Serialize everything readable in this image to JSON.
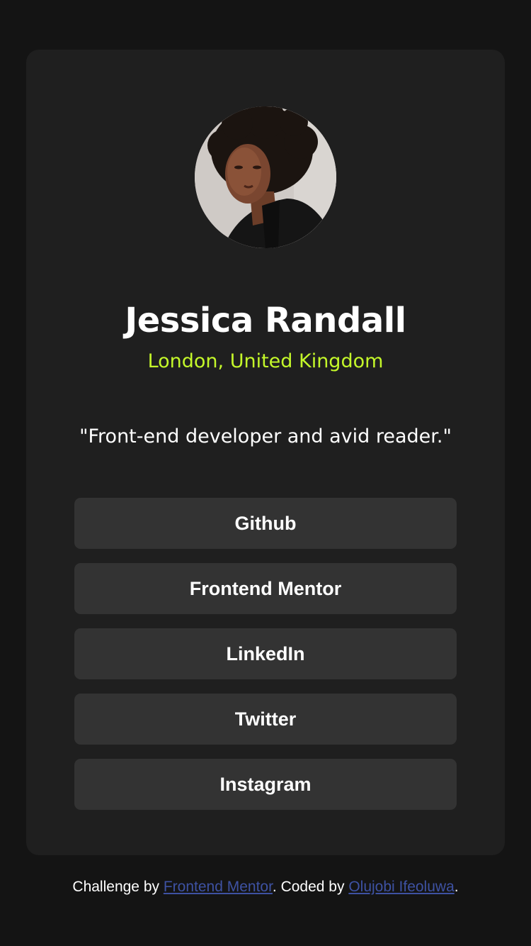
{
  "profile": {
    "name": "Jessica Randall",
    "location": "London, United Kingdom",
    "bio": "\"Front-end developer and avid reader.\"",
    "avatar_icon": "profile-photo"
  },
  "links": [
    {
      "label": "Github"
    },
    {
      "label": "Frontend Mentor"
    },
    {
      "label": "LinkedIn"
    },
    {
      "label": "Twitter"
    },
    {
      "label": "Instagram"
    }
  ],
  "footer": {
    "prefix": "Challenge by ",
    "challenge_link": "Frontend Mentor",
    "middle": ". Coded by ",
    "author_link": "Olujobi Ifeoluwa",
    "suffix": "."
  },
  "colors": {
    "background": "#141414",
    "card": "#1f1f1f",
    "button": "#333333",
    "accent": "#c4f82a",
    "link": "#3e52a3"
  }
}
